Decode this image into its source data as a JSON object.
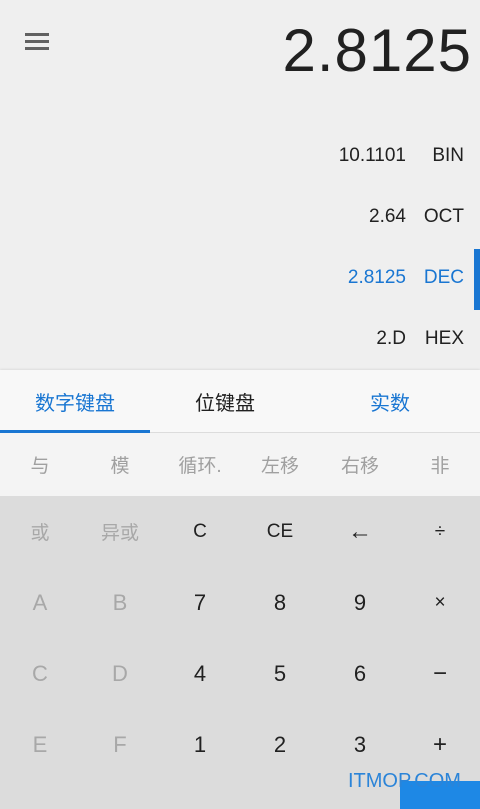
{
  "display": {
    "value": "2.8125"
  },
  "bases": [
    {
      "value": "10.1101",
      "name": "BIN",
      "active": false
    },
    {
      "value": "2.64",
      "name": "OCT",
      "active": false
    },
    {
      "value": "2.8125",
      "name": "DEC",
      "active": true
    },
    {
      "value": "2.D",
      "name": "HEX",
      "active": false
    }
  ],
  "tabs": [
    {
      "label": "数字键盘"
    },
    {
      "label": "位键盘"
    },
    {
      "label": "实数"
    }
  ],
  "bitops": [
    "与",
    "模",
    "循环.",
    "左移",
    "右移",
    "非"
  ],
  "keys": [
    [
      "或",
      "异或",
      "C",
      "CE",
      "←",
      "÷"
    ],
    [
      "A",
      "B",
      "7",
      "8",
      "9",
      "×"
    ],
    [
      "C",
      "D",
      "4",
      "5",
      "6",
      "−"
    ],
    [
      "E",
      "F",
      "1",
      "2",
      "3",
      "+"
    ]
  ],
  "watermark": "ITMOP.COM",
  "colors": {
    "accent": "#1976d2"
  },
  "icons": {
    "menu": "menu-icon"
  }
}
